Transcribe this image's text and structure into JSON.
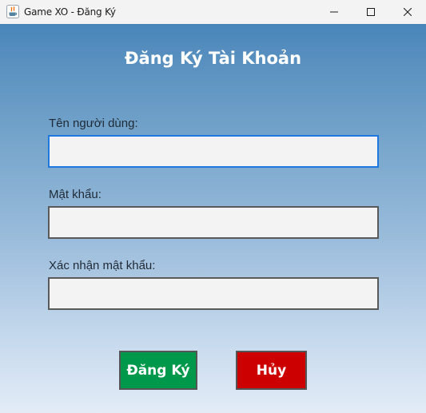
{
  "window": {
    "title": "Game XO - Đăng Ký",
    "icon": "java-icon",
    "controls": [
      "minimize-icon",
      "maximize-icon",
      "close-icon"
    ]
  },
  "form": {
    "heading": "Đăng Ký Tài Khoản",
    "username": {
      "label": "Tên người dùng:",
      "value": ""
    },
    "password": {
      "label": "Mật khẩu:",
      "value": ""
    },
    "confirm_password": {
      "label": "Xác nhận mật khẩu:",
      "value": ""
    }
  },
  "actions": {
    "register_label": "Đăng Ký",
    "cancel_label": "Hủy"
  },
  "colors": {
    "register": "#00984a",
    "cancel": "#cc0000",
    "focus_border": "#1f78e0",
    "gradient_top": "#4a86ba",
    "gradient_bottom": "#e3ecf7"
  }
}
